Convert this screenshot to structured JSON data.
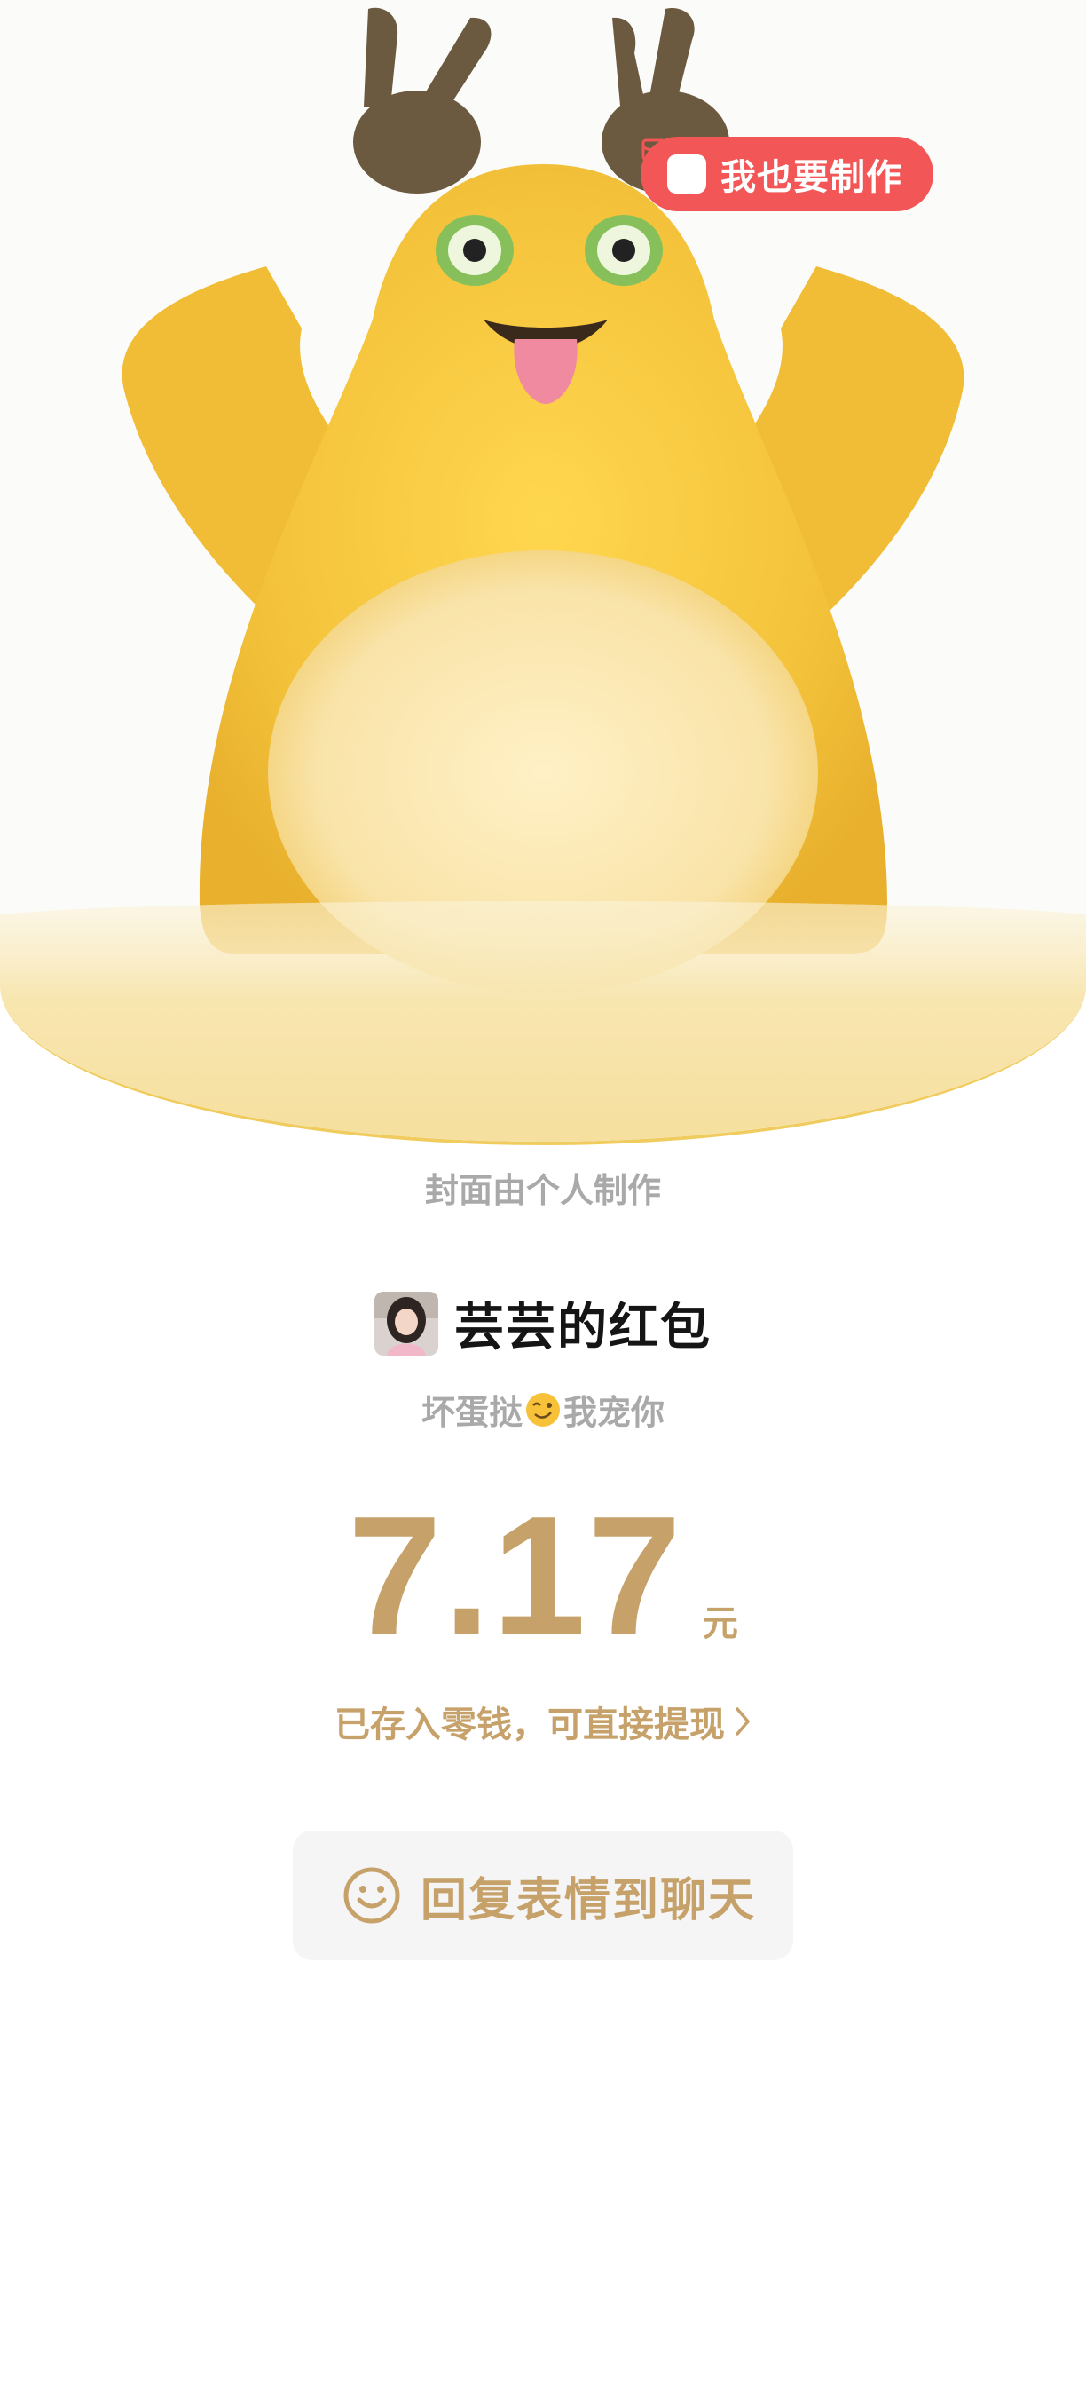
{
  "cover": {
    "make_button_label": "我也要制作",
    "note": "封面由个人制作"
  },
  "sender": {
    "name": "芸芸的红包",
    "avatar": "avatar-photo"
  },
  "greeting": {
    "before": "坏蛋挞",
    "emoji": "winking-face",
    "after": "我宠你"
  },
  "amount": {
    "value": "7.17",
    "unit": "元"
  },
  "saved_note": "已存入零钱，可直接提现",
  "reply_button": {
    "label": "回复表情到聊天",
    "icon": "smiley-icon"
  },
  "colors": {
    "gold": "#c6a26a",
    "make_button": "#f25656",
    "mascot_yellow": "#f4c73e",
    "grey_text": "#a9a9a9"
  }
}
